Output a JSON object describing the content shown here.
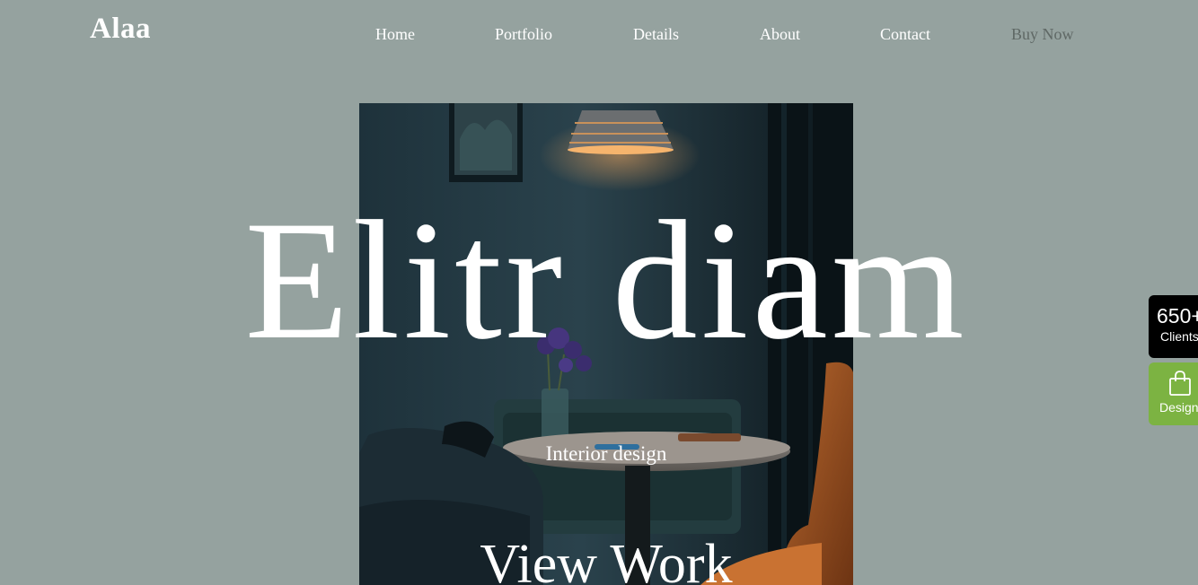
{
  "header": {
    "logo": "Alaa",
    "nav": {
      "home": "Home",
      "portfolio": "Portfolio",
      "details": "Details",
      "about": "About",
      "contact": "Contact",
      "buy_now": "Buy Now"
    }
  },
  "hero": {
    "title": "Elitr diam",
    "subtitle": "Interior design",
    "cta": "View Work",
    "image_icon": "interior-photo"
  },
  "side_widgets": {
    "clients_count": "650+",
    "clients_label": "Clients",
    "design_label": "Design",
    "design_icon": "shopping-bag-icon"
  },
  "colors": {
    "background": "#95a29f",
    "text": "#ffffff",
    "buy_now": "#5f6865",
    "clients_badge": "#000000",
    "design_badge": "#7cb342"
  }
}
